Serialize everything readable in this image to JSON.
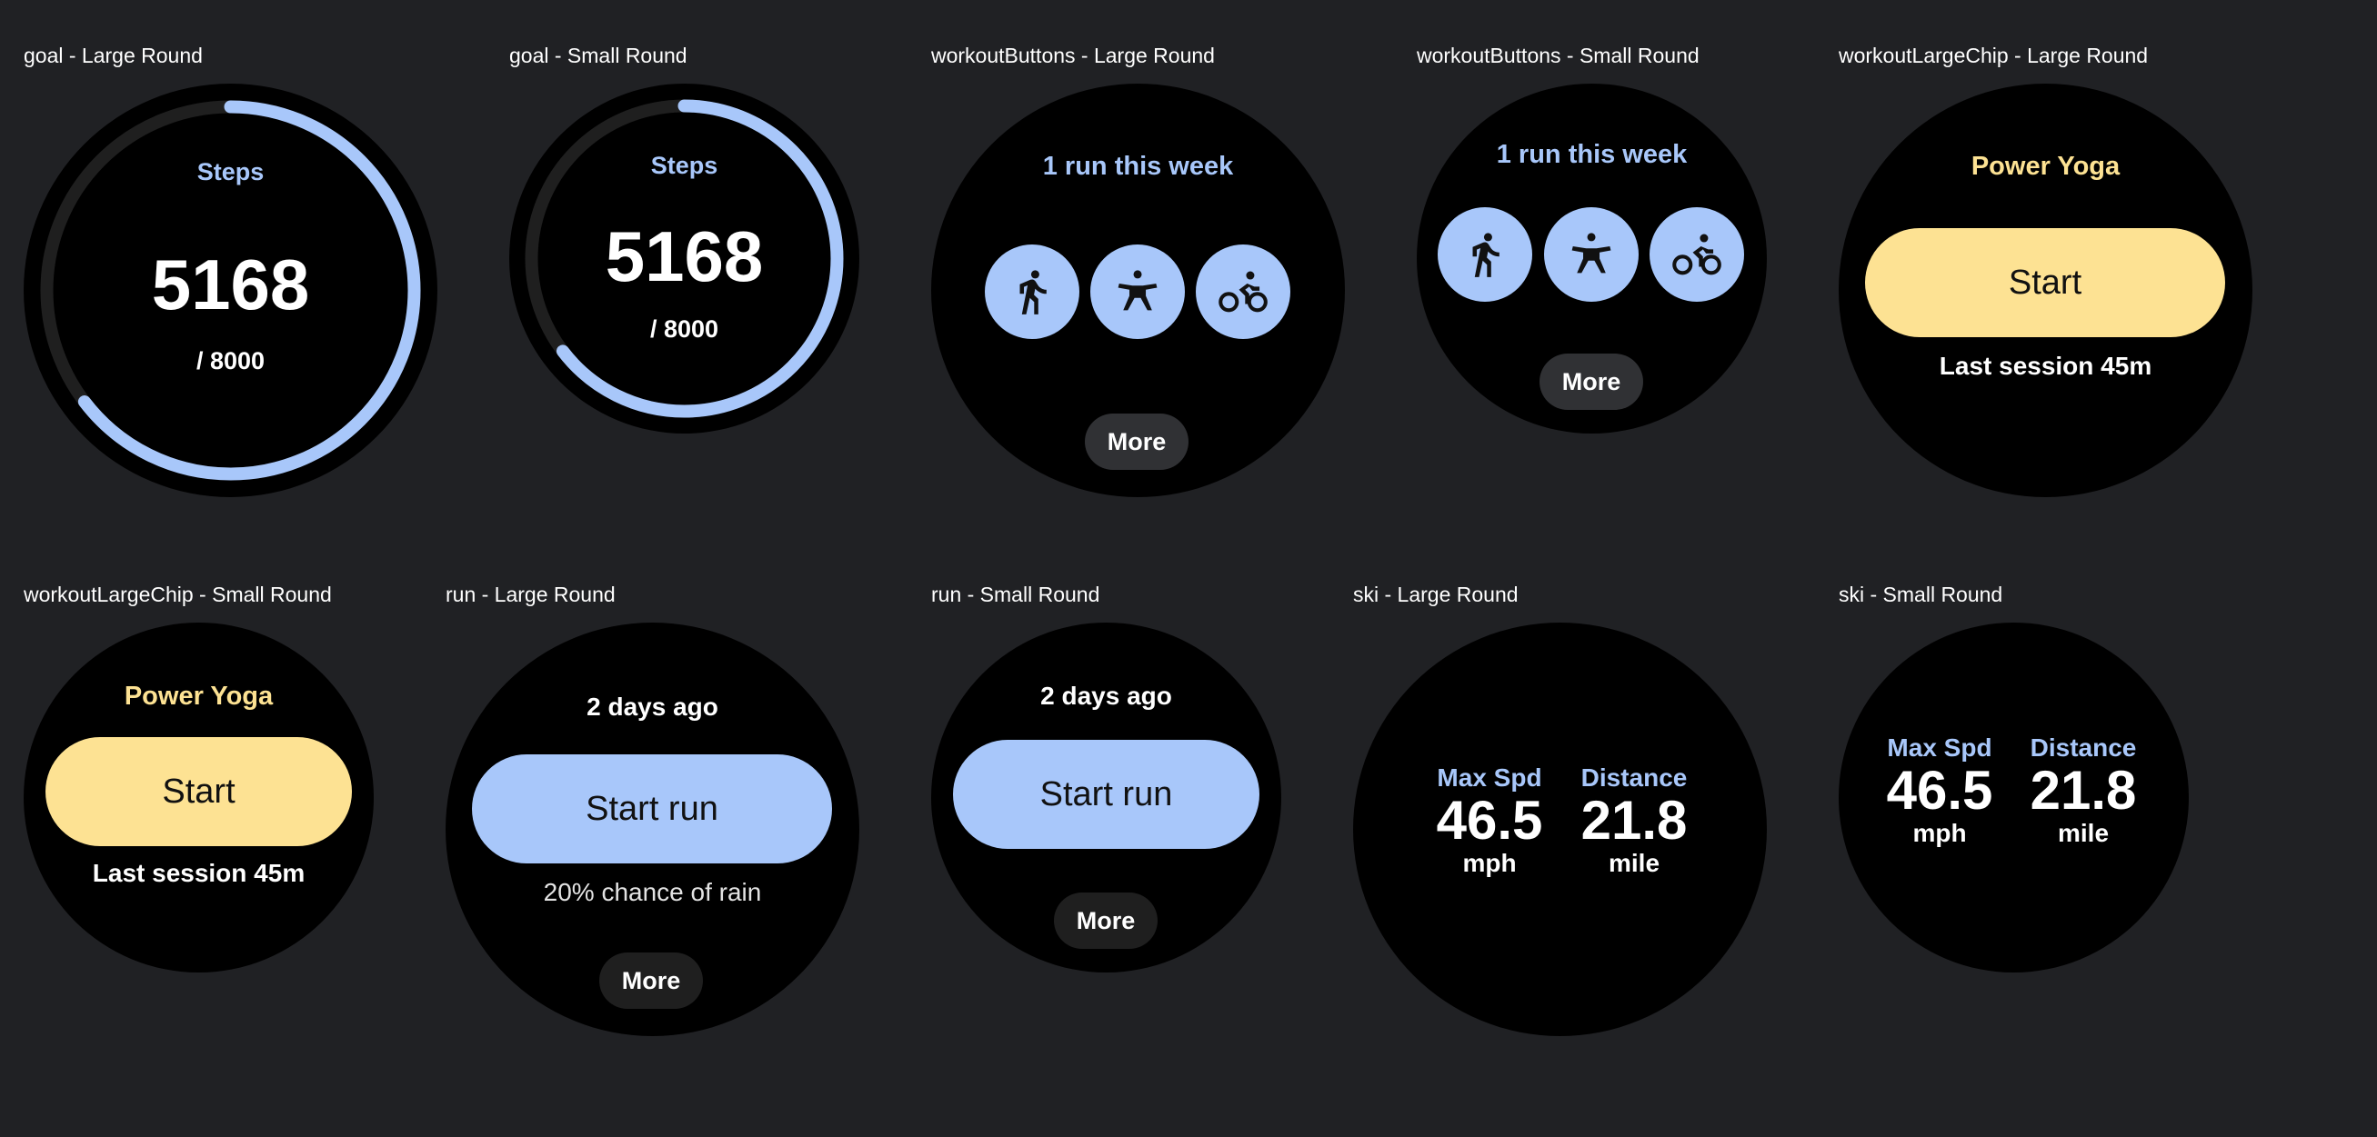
{
  "captions": {
    "goal_large": "goal - Large Round",
    "goal_small": "goal - Small Round",
    "wb_large": "workoutButtons - Large Round",
    "wb_small": "workoutButtons - Small Round",
    "wlc_large": "workoutLargeChip - Large Round",
    "wlc_small": "workoutLargeChip - Small Round",
    "run_large": "run - Large Round",
    "run_small": "run - Small Round",
    "ski_large": "ski - Large Round",
    "ski_small": "ski - Small Round"
  },
  "goal": {
    "label": "Steps",
    "value": "5168",
    "target": "/ 8000",
    "progress": 0.646
  },
  "workout_buttons": {
    "title": "1 run this week",
    "icons": [
      "run-icon",
      "yoga-icon",
      "cycle-icon"
    ],
    "more": "More"
  },
  "workout_large_chip": {
    "title": "Power Yoga",
    "button": "Start",
    "subtitle": "Last session 45m"
  },
  "run": {
    "title": "2 days ago",
    "button": "Start run",
    "subtitle": "20% chance of rain",
    "more": "More"
  },
  "ski": {
    "stats": [
      {
        "label": "Max Spd",
        "value": "46.5",
        "unit": "mph"
      },
      {
        "label": "Distance",
        "value": "21.8",
        "unit": "mile"
      }
    ]
  },
  "colors": {
    "background": "#202124",
    "accent_blue": "#a8c7fa",
    "accent_yellow": "#fde293",
    "chip_gray": "#303134"
  }
}
